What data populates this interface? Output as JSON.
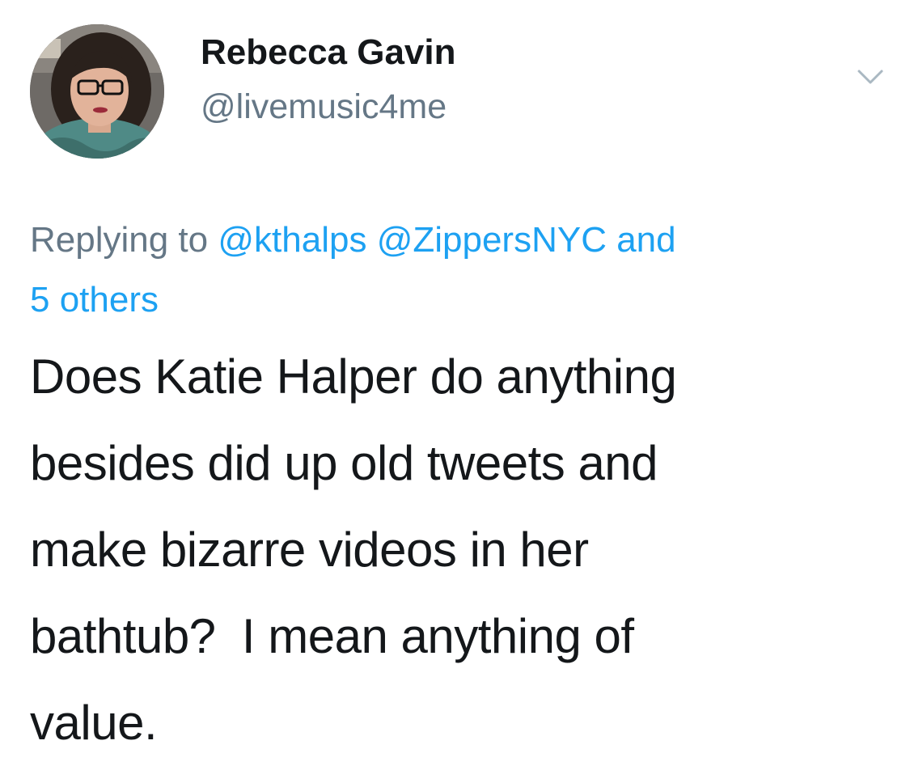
{
  "author": {
    "display_name": "Rebecca Gavin",
    "handle": "@livemusic4me",
    "avatar_icon": "profile-photo"
  },
  "menu": {
    "icon": "chevron-down-icon"
  },
  "reply_context": {
    "prefix": "Replying to",
    "mentions": [
      "@kthalps",
      "@ZippersNYC"
    ],
    "conjunction": "and",
    "others": "5 others"
  },
  "tweet": {
    "lines": [
      "Does Katie Halper do anything",
      "besides did up old tweets and",
      "make bizarre videos in her",
      "bathtub?  I mean anything of",
      "value."
    ]
  },
  "colors": {
    "link": "#1da1f2",
    "secondary_text": "#657786",
    "primary_text": "#14171a",
    "background": "#ffffff"
  }
}
